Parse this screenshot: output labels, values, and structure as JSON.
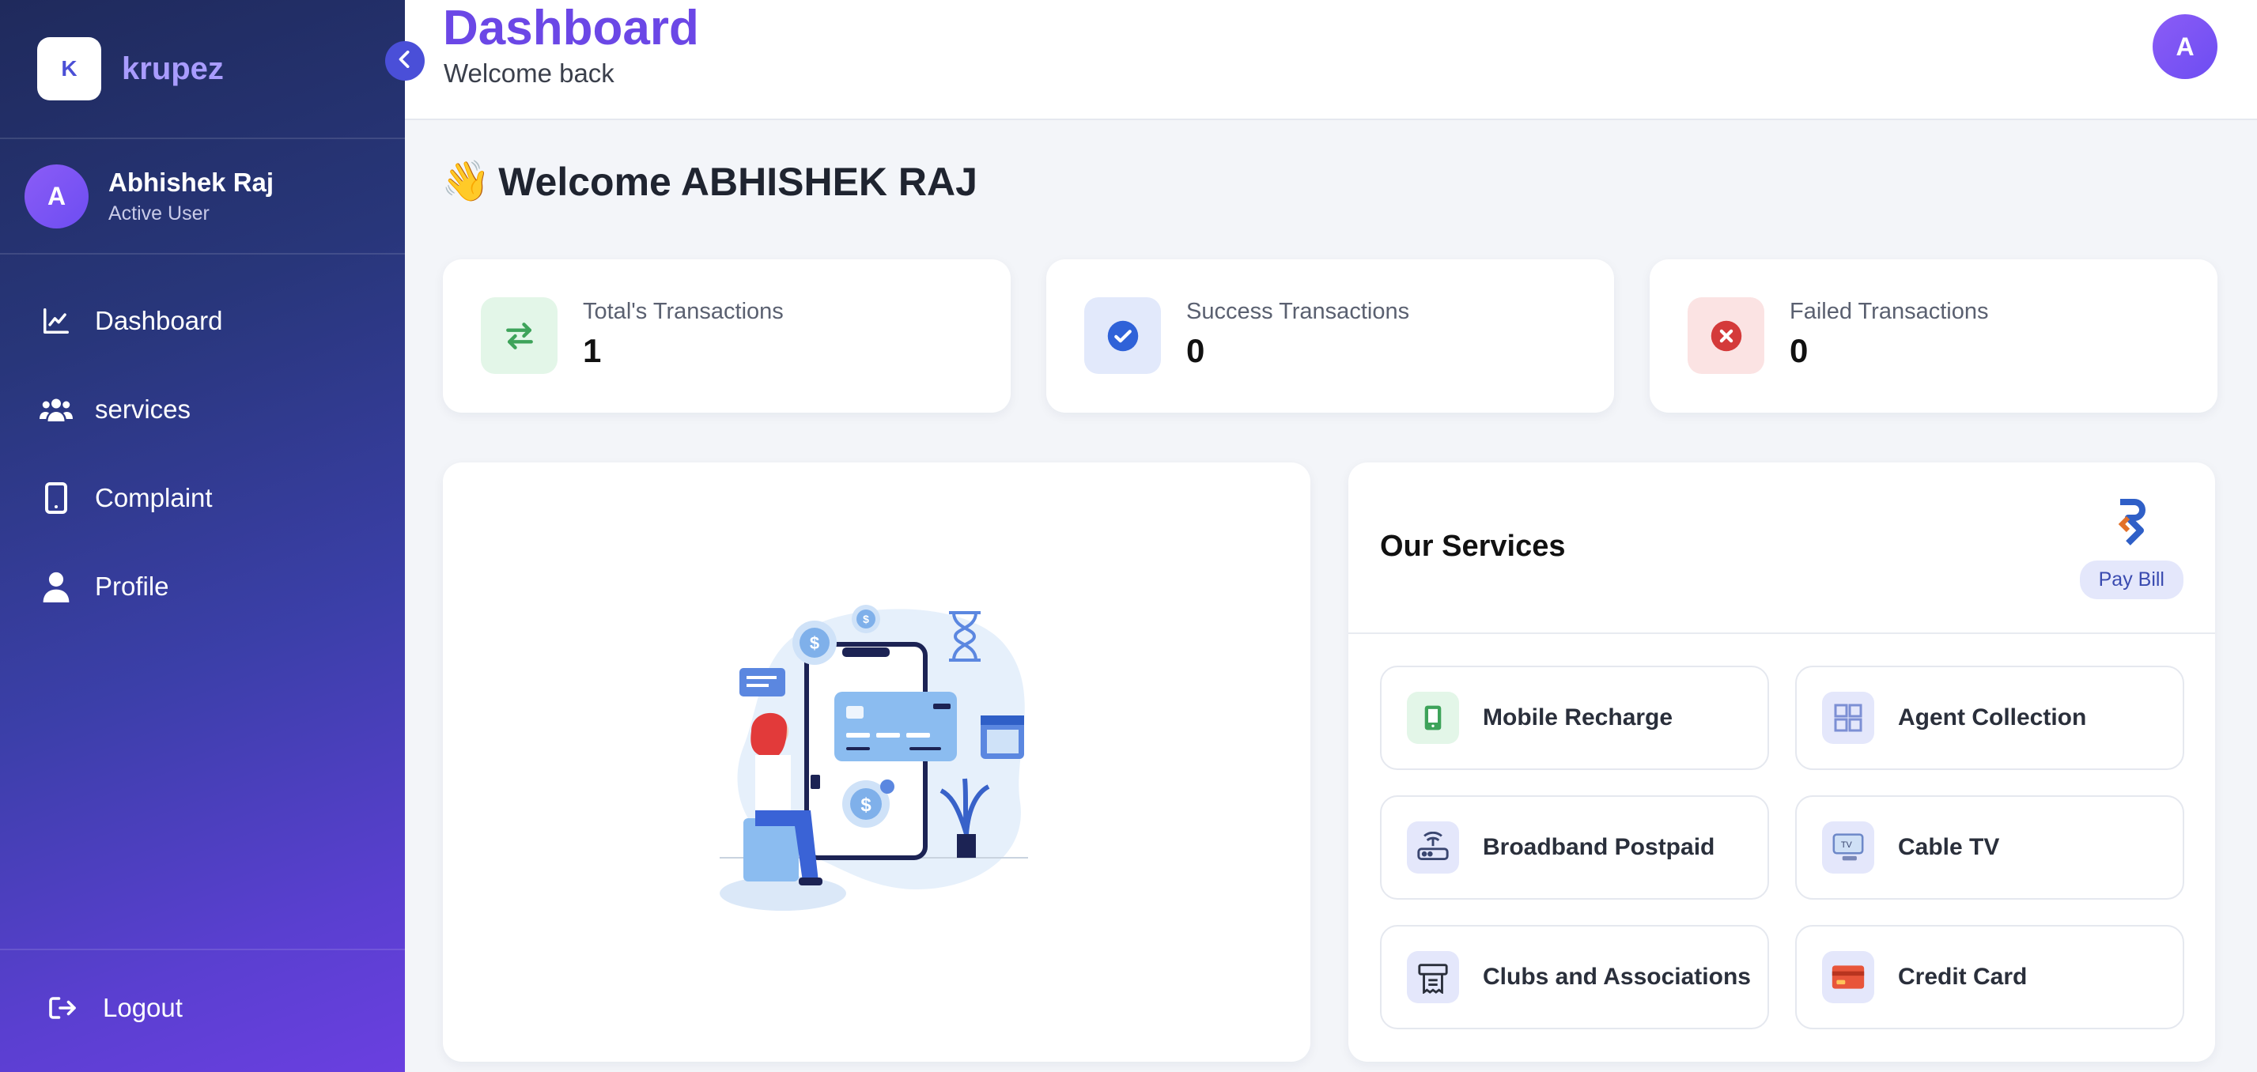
{
  "sidebar": {
    "brand_initial": "K",
    "brand_name": "krupez",
    "user": {
      "initial": "A",
      "name": "Abhishek Raj",
      "status": "Active User"
    },
    "nav": [
      {
        "label": "Dashboard",
        "icon": "chart-line-icon"
      },
      {
        "label": "services",
        "icon": "users-icon"
      },
      {
        "label": "Complaint",
        "icon": "mobile-icon"
      },
      {
        "label": "Profile",
        "icon": "user-icon"
      }
    ],
    "logout_label": "Logout"
  },
  "header": {
    "title": "Dashboard",
    "subtitle": "Welcome back",
    "avatar_initial": "A"
  },
  "welcome": {
    "emoji": "👋",
    "text": "Welcome ABHISHEK RAJ"
  },
  "stats": [
    {
      "label": "Total's Transactions",
      "value": "1",
      "icon": "swap-arrows-icon",
      "color": "#3ea35a",
      "bg": "#e3f6e8"
    },
    {
      "label": "Success Transactions",
      "value": "0",
      "icon": "check-circle-icon",
      "color": "#2f62d8",
      "bg": "#e2e9fb"
    },
    {
      "label": "Failed Transactions",
      "value": "0",
      "icon": "x-circle-icon",
      "color": "#d43a3a",
      "bg": "#fbe3e3"
    }
  ],
  "services": {
    "title": "Our Services",
    "paybill_label": "Pay Bill",
    "items": [
      {
        "label": "Mobile Recharge",
        "icon": "mobile-recharge-icon"
      },
      {
        "label": "Agent Collection",
        "icon": "agent-collection-icon"
      },
      {
        "label": "Broadband Postpaid",
        "icon": "router-icon"
      },
      {
        "label": "Cable TV",
        "icon": "tv-icon"
      },
      {
        "label": "Clubs and Associations",
        "icon": "receipt-icon"
      },
      {
        "label": "Credit Card",
        "icon": "credit-card-icon"
      }
    ]
  },
  "colors": {
    "accent": "#6b47e6",
    "sidebar_start": "#1f2a5c",
    "sidebar_end": "#6a3fe0"
  }
}
